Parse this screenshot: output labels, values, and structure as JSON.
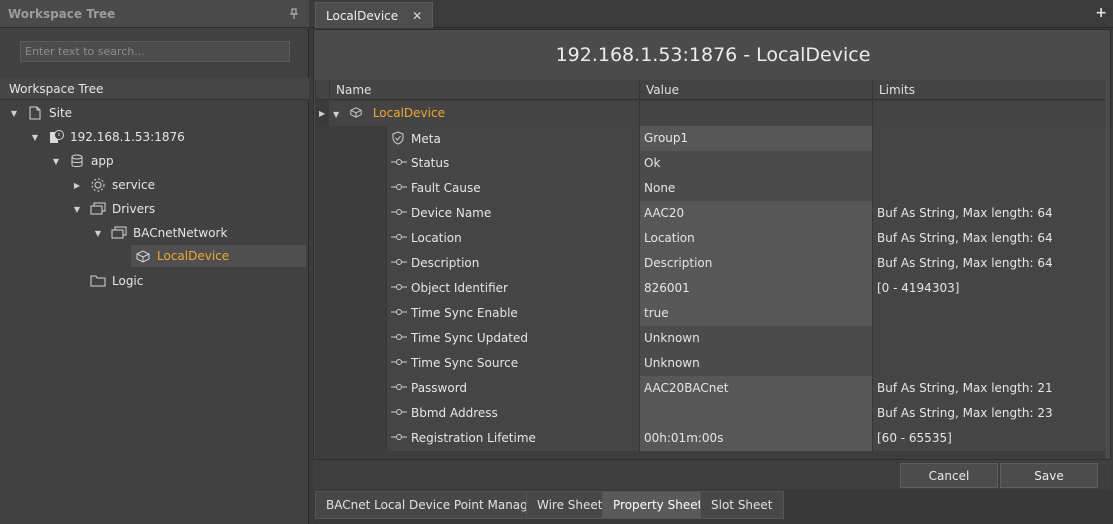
{
  "workspace": {
    "title": "Workspace Tree",
    "search_placeholder": "Enter text to search...",
    "tree_label": "Workspace Tree",
    "tree": [
      {
        "label": "Site",
        "icon": "file-icon",
        "expanded": true
      },
      {
        "label": "192.168.1.53:1876",
        "icon": "device-server-icon",
        "expanded": true
      },
      {
        "label": "app",
        "icon": "database-icon",
        "expanded": true
      },
      {
        "label": "service",
        "icon": "gear-icon",
        "expanded": false
      },
      {
        "label": "Drivers",
        "icon": "folder-stack-icon",
        "expanded": true
      },
      {
        "label": "BACnetNetwork",
        "icon": "network-icon",
        "expanded": true
      },
      {
        "label": "LocalDevice",
        "icon": "local-device-icon",
        "selected": true
      },
      {
        "label": "Logic",
        "icon": "folder-icon"
      }
    ]
  },
  "tabs": {
    "active": "LocalDevice",
    "close_symbol": "✕",
    "add_symbol": "+"
  },
  "content": {
    "title": "192.168.1.53:1876 - LocalDevice",
    "columns": {
      "name": "Name",
      "value": "Value",
      "limits": "Limits"
    },
    "root": "LocalDevice",
    "rows": [
      {
        "name": "Meta",
        "value": "Group1",
        "limits": "",
        "icon": "shield-icon"
      },
      {
        "name": "Status",
        "value": "Ok",
        "limits": "",
        "icon": "property-icon"
      },
      {
        "name": "Fault Cause",
        "value": "None",
        "limits": "",
        "icon": "property-icon"
      },
      {
        "name": "Device Name",
        "value": "AAC20",
        "limits": "Buf As String, Max length: 64",
        "icon": "property-icon"
      },
      {
        "name": "Location",
        "value": "Location",
        "limits": "Buf As String, Max length: 64",
        "icon": "property-icon"
      },
      {
        "name": "Description",
        "value": "Description",
        "limits": "Buf As String, Max length: 64",
        "icon": "property-icon"
      },
      {
        "name": "Object Identifier",
        "value": "826001",
        "limits": "[0 - 4194303]",
        "icon": "property-icon"
      },
      {
        "name": "Time Sync Enable",
        "value": "true",
        "limits": "",
        "icon": "property-icon"
      },
      {
        "name": "Time Sync Updated",
        "value": "Unknown",
        "limits": "",
        "icon": "property-icon"
      },
      {
        "name": "Time Sync Source",
        "value": "Unknown",
        "limits": "",
        "icon": "property-icon"
      },
      {
        "name": "Password",
        "value": "AAC20BACnet",
        "limits": "Buf As String, Max length: 21",
        "icon": "property-icon"
      },
      {
        "name": "Bbmd Address",
        "value": "",
        "limits": "Buf As String, Max length: 23",
        "icon": "property-icon"
      },
      {
        "name": "Registration Lifetime",
        "value": "00h:01m:00s",
        "limits": "[60 - 65535]",
        "icon": "property-icon"
      }
    ]
  },
  "footer": {
    "cancel": "Cancel",
    "save": "Save"
  },
  "bottom_tabs": [
    {
      "label": "BACnet Local Device Point Manager"
    },
    {
      "label": "Wire Sheet"
    },
    {
      "label": "Property Sheet",
      "active": true
    },
    {
      "label": "Slot Sheet"
    }
  ],
  "colors": {
    "background": "#3c3c3c",
    "selected_text": "#f0a830",
    "panel": "#414141"
  }
}
